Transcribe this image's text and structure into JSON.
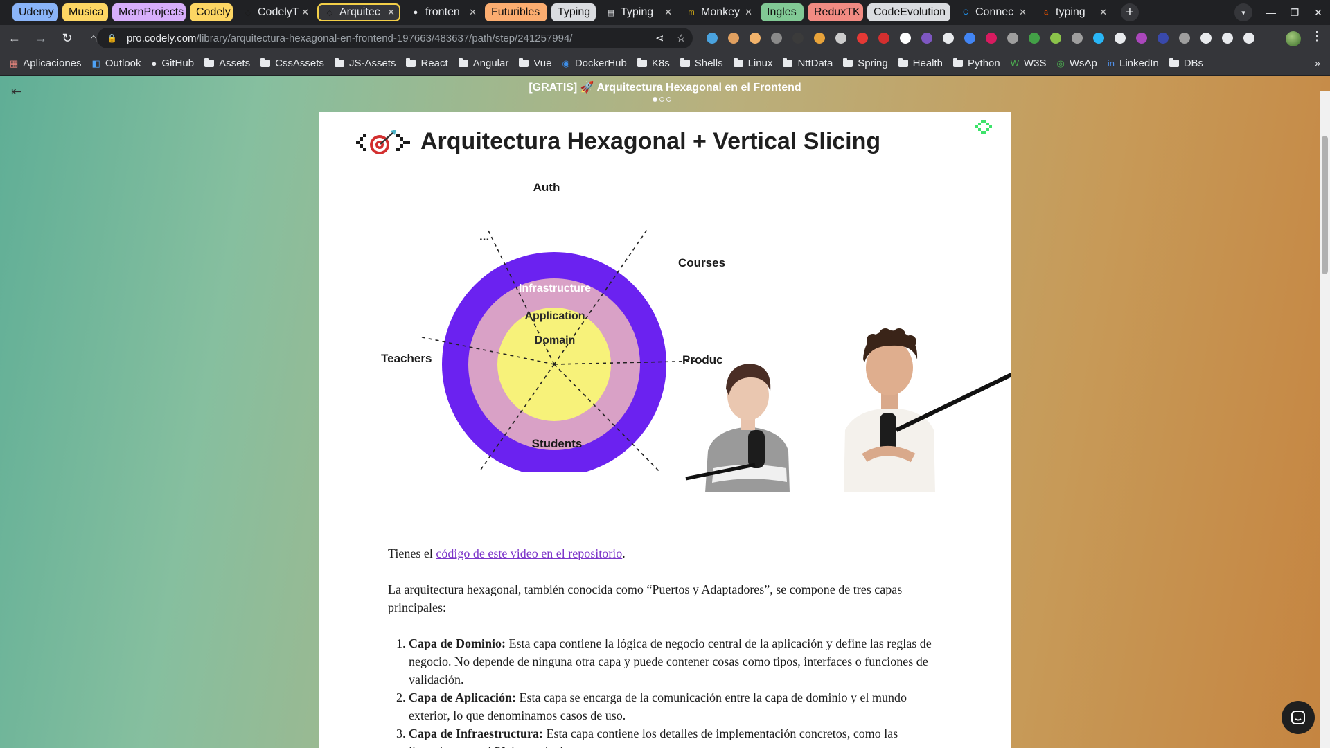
{
  "tabs": [
    {
      "type": "group",
      "label": "Udemy",
      "color": "#8ab4f8"
    },
    {
      "type": "group",
      "label": "Musica",
      "color": "#fdd663"
    },
    {
      "type": "group",
      "label": "MernProjects",
      "color": "#d7aefb"
    },
    {
      "type": "group",
      "label": "Codely",
      "color": "#fdd663"
    },
    {
      "type": "tab",
      "label": "CodelyT",
      "favicon": "codely"
    },
    {
      "type": "tab",
      "label": "Arquitec",
      "favicon": "codely",
      "active": true
    },
    {
      "type": "tab",
      "label": "fronten",
      "favicon": "github"
    },
    {
      "type": "group",
      "label": "Futuribles",
      "color": "#fcad70"
    },
    {
      "type": "group",
      "label": "Typing",
      "color": "#dadce0"
    },
    {
      "type": "tab",
      "label": "Typing",
      "favicon": "doc"
    },
    {
      "type": "tab",
      "label": "Monkey",
      "favicon": "monkey"
    },
    {
      "type": "group",
      "label": "Ingles",
      "color": "#81c995"
    },
    {
      "type": "group",
      "label": "ReduxTK",
      "color": "#f28b82"
    },
    {
      "type": "group",
      "label": "CodeEvolution",
      "color": "#dadce0"
    },
    {
      "type": "tab",
      "label": "Connec",
      "favicon": "connect"
    },
    {
      "type": "tab",
      "label": "typing",
      "favicon": "ask"
    }
  ],
  "toolbar": {
    "url_host": "pro.codely.com",
    "url_path": "/library/arquitectura-hexagonal-en-frontend-197663/483637/path/step/241257994/"
  },
  "extensions": [
    "#4aa3df",
    "#e0a060",
    "#f2b36b",
    "#8a8a8a",
    "#3b3b3b",
    "#e8a33a",
    "#cccccc",
    "#e53935",
    "#d32f2f",
    "#ffffff",
    "#7e57c2",
    "#e8eaed",
    "#4285f4",
    "#d81b60",
    "#9e9e9e",
    "#43a047",
    "#8bc34a",
    "#9e9e9e",
    "#29b6f6",
    "#e8eaed",
    "#ab47bc",
    "#3949ab",
    "#9e9e9e",
    "#e8eaed",
    "#e8eaed",
    "#e8eaed"
  ],
  "bookmarks": [
    {
      "label": "Aplicaciones",
      "icon": "apps-icon"
    },
    {
      "label": "Outlook",
      "icon": "outlook-icon"
    },
    {
      "label": "GitHub",
      "icon": "github-icon"
    },
    {
      "label": "Assets",
      "icon": "folder"
    },
    {
      "label": "CssAssets",
      "icon": "folder"
    },
    {
      "label": "JS-Assets",
      "icon": "folder"
    },
    {
      "label": "React",
      "icon": "folder"
    },
    {
      "label": "Angular",
      "icon": "folder"
    },
    {
      "label": "Vue",
      "icon": "folder"
    },
    {
      "label": "DockerHub",
      "icon": "docker-icon"
    },
    {
      "label": "K8s",
      "icon": "folder"
    },
    {
      "label": "Shells",
      "icon": "folder"
    },
    {
      "label": "Linux",
      "icon": "folder"
    },
    {
      "label": "NttData",
      "icon": "folder"
    },
    {
      "label": "Spring",
      "icon": "folder"
    },
    {
      "label": "Health",
      "icon": "folder"
    },
    {
      "label": "Python",
      "icon": "folder"
    },
    {
      "label": "W3S",
      "icon": "w3s-icon"
    },
    {
      "label": "WsAp",
      "icon": "whatsapp-icon"
    },
    {
      "label": "LinkedIn",
      "icon": "linkedin-icon"
    },
    {
      "label": "DBs",
      "icon": "folder"
    }
  ],
  "page": {
    "heading": "[GRATIS] 🚀 Arquitectura Hexagonal en el Frontend",
    "slide_title": "Arquitectura Hexagonal + Vertical Slicing",
    "diagram": {
      "rings": [
        "Infrastructure",
        "Application",
        "Domain"
      ],
      "slices": [
        "Auth",
        "Courses",
        "Produc",
        "Students",
        "Teachers",
        "..."
      ],
      "colors": {
        "infrastructure": "#6b22f0",
        "application": "#d9a1c6",
        "domain": "#f7f27a"
      }
    },
    "article": {
      "intro_prefix": "Tienes el ",
      "intro_link": "código de este video en el repositorio",
      "intro_suffix": ".",
      "para2": "La arquitectura hexagonal, también conocida como “Puertos y Adaptadores”, se compone de tres capas principales:",
      "items": [
        {
          "title": "Capa de Dominio:",
          "text": " Esta capa contiene la lógica de negocio central de la aplicación y define las reglas de negocio. No depende de ninguna otra capa y puede contener cosas como tipos, interfaces o funciones de validación."
        },
        {
          "title": "Capa de Aplicación:",
          "text": " Esta capa se encarga de la comunicación entre la capa de dominio y el mundo exterior, lo que denominamos casos de uso."
        },
        {
          "title": "Capa de Infraestructura:",
          "text": " Esta capa contiene los detalles de implementación concretos, como las llamadas a una API, bases de datos, etc."
        }
      ]
    }
  }
}
